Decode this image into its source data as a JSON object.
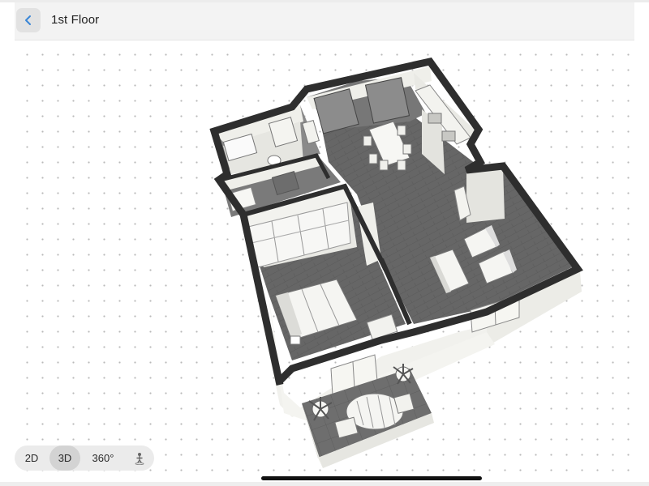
{
  "header": {
    "back_icon": "chevron-left-icon",
    "title": "1st Floor"
  },
  "view_toggle": {
    "options": [
      {
        "label": "2D",
        "active": false
      },
      {
        "label": "3D",
        "active": true
      },
      {
        "label": "360°",
        "active": false
      }
    ],
    "avatar_icon": "person-walk-icon"
  },
  "colors": {
    "accent": "#3a86d6",
    "floor": "#6b6b6b",
    "wall_top": "#2e2e2e",
    "wall_side": "#eeeeea",
    "grid_dot": "#b9b9b9"
  }
}
